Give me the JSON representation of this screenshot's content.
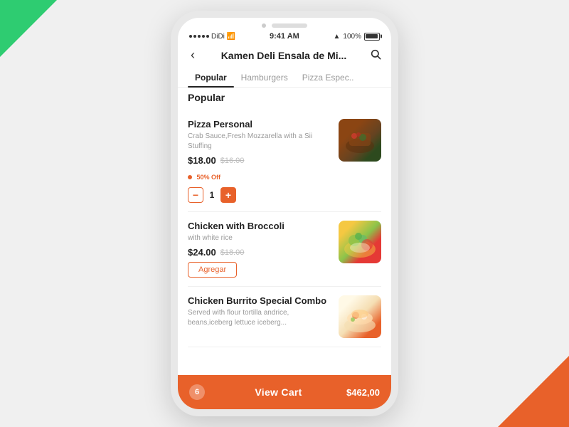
{
  "background": {
    "corner_tl_color": "#2ecc71",
    "corner_br_color": "#e8612a"
  },
  "status_bar": {
    "carrier": "DiDi",
    "time": "9:41 AM",
    "battery": "100%",
    "signal_label": "signal"
  },
  "nav": {
    "back_icon": "←",
    "title": "Kamen Deli Ensala de Mi...",
    "search_icon": "🔍"
  },
  "tabs": [
    {
      "label": "Popular",
      "active": true
    },
    {
      "label": "Hamburgers",
      "active": false
    },
    {
      "label": "Pizza Espec..",
      "active": false
    }
  ],
  "section_title": "Popular",
  "menu_items": [
    {
      "id": 1,
      "name": "Pizza Personal",
      "description": "Crab Sauce,Fresh Mozzarella with a Sii Stuffing",
      "price_current": "$18.00",
      "price_original": "$16.00",
      "discount": "50% Off",
      "has_stepper": true,
      "qty": 1,
      "image_class": "food-1"
    },
    {
      "id": 2,
      "name": "Chicken with Broccoli",
      "description": "with white rice",
      "price_current": "$24.00",
      "price_original": "$18.00",
      "discount": "",
      "has_stepper": false,
      "agregar_label": "Agregar",
      "image_class": "food-2"
    },
    {
      "id": 3,
      "name": "Chicken Burrito Special Combo",
      "description": "Served with flour tortilla andrice, beans,iceberg lettuce iceberg...",
      "price_current": "",
      "price_original": "",
      "discount": "",
      "has_stepper": false,
      "image_class": "food-3"
    }
  ],
  "cart": {
    "count": "6",
    "label": "View Cart",
    "total": "$462,00"
  }
}
